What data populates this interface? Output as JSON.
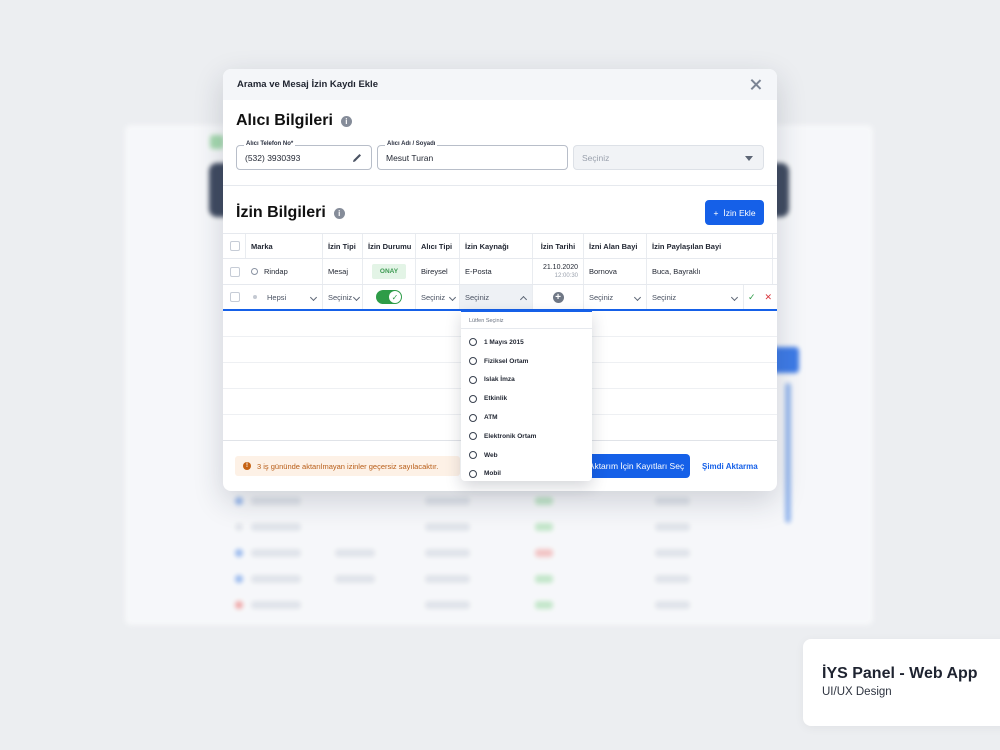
{
  "modal": {
    "title": "Arama ve Mesaj İzin Kaydı Ekle",
    "recipient_section_title": "Alıcı Bilgileri",
    "phone": {
      "label": "Alıcı Telefon No*",
      "value": "(532) 3930393"
    },
    "name": {
      "label": "Alıcı Adı / Soyadı",
      "value": "Mesut Turan"
    },
    "third_select": {
      "placeholder": "Seçiniz"
    },
    "permission_section_title": "İzin Bilgileri",
    "add_permission_label": "İzin Ekle",
    "columns": [
      "Marka",
      "İzin Tipi",
      "İzin Durumu",
      "Alıcı Tipi",
      "İzin Kaynağı",
      "İzin Tarihi",
      "İzni Alan Bayi",
      "İzin Paylaşılan Bayi"
    ],
    "row": {
      "brand": "Rindap",
      "type": "Mesaj",
      "status": "ONAY",
      "recipient_type": "Bireysel",
      "source": "E-Posta",
      "date": "21.10.2020",
      "time": "12:00:30",
      "receiving_dealer": "Bornova",
      "shared_dealer": "Buca, Bayraklı"
    },
    "edit_row": {
      "brand": "Hepsi",
      "type": "Seçiniz",
      "recipient_type": "Seçiniz",
      "source": "Seçiniz",
      "receiving_dealer": "Seçiniz",
      "shared_dealer": "Seçiniz"
    },
    "warning": "3 iş gününde aktarılmayan izinler geçersiz sayılacaktır.",
    "select_for_transfer_label": "Aktarım İçin Kayıtları Seç",
    "transfer_now_label": "Şimdi Aktarma"
  },
  "dropdown": {
    "header": "Lütfen Seçiniz",
    "options": [
      "1 Mayıs 2015",
      "Fiziksel Ortam",
      "Islak İmza",
      "Etkinlik",
      "ATM",
      "Elektronik Ortam",
      "Web",
      "Mobil"
    ]
  },
  "caption": {
    "title": "İYS Panel - Web App",
    "subtitle": "UI/UX Design"
  },
  "colors": {
    "primary": "#1560e8",
    "success": "#2e9c48",
    "warning": "#c66314"
  }
}
